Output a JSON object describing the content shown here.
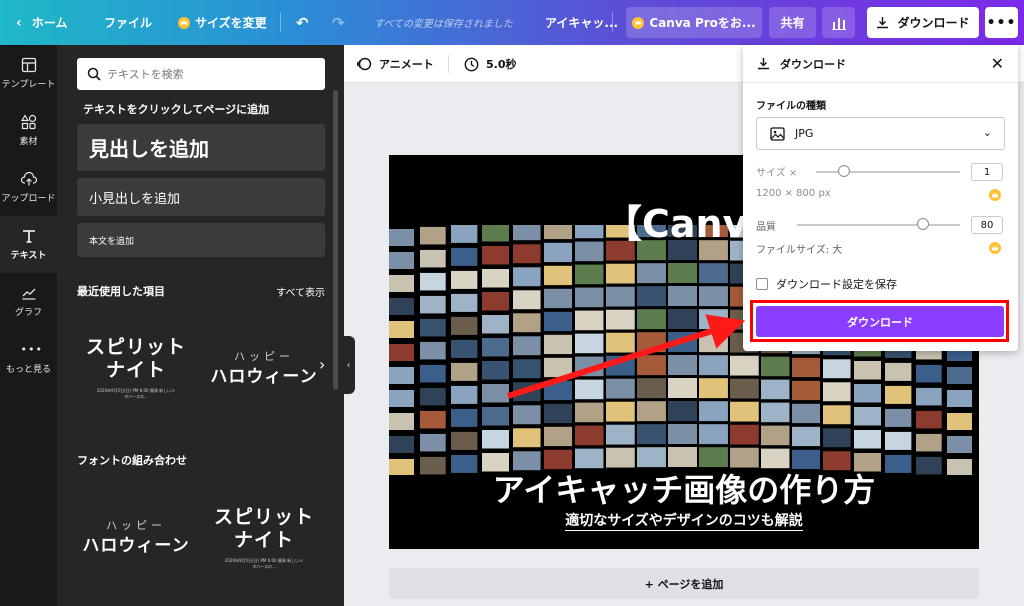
{
  "topbar": {
    "home": "ホーム",
    "file": "ファイル",
    "resize": "サイズを変更",
    "saved_status": "すべての変更は保存されました",
    "doc_title": "アイキャッ...",
    "pro_trial": "Canva Proをお...",
    "share": "共有",
    "download": "ダウンロード"
  },
  "rail": {
    "items": [
      {
        "label": "テンプレート",
        "icon": "template-icon"
      },
      {
        "label": "素材",
        "icon": "elements-icon"
      },
      {
        "label": "アップロード",
        "icon": "upload-icon"
      },
      {
        "label": "テキスト",
        "icon": "text-icon"
      },
      {
        "label": "グラフ",
        "icon": "chart-icon"
      },
      {
        "label": "もっと見る",
        "icon": "more-icon"
      }
    ]
  },
  "panel": {
    "search_placeholder": "テキストを検索",
    "click_hint": "テキストをクリックしてページに追加",
    "heading_btn": "見出しを追加",
    "subheading_btn": "小見出しを追加",
    "body_btn": "本文を追加",
    "recent_title": "最近使用した項目",
    "see_all": "すべて表示",
    "combo_title": "フォントの組み合わせ",
    "card_spirit": "スピリット\nナイト",
    "card_happy": "ハッピー",
    "card_halloween": "ハロウィーン",
    "card_small_text": "2020年9月5日(日) PM 6:00 開演 新しいメタバースの..."
  },
  "editor": {
    "animate": "アニメート",
    "duration": "5.0秒",
    "add_page": "+ ページを追加"
  },
  "canvas": {
    "title": "【Canva",
    "headline": "アイキャッチ画像の作り方",
    "subline": "適切なサイズやデザインのコツも解説"
  },
  "download_popup": {
    "title": "ダウンロード",
    "file_type_label": "ファイルの種類",
    "file_type_value": "JPG",
    "size_label": "サイズ ×",
    "size_value": "1",
    "dimensions": "1200 × 800 px",
    "quality_label": "品質",
    "quality_value": "80",
    "file_size": "ファイルサイズ: 大",
    "save_settings": "ダウンロード設定を保存",
    "download_button": "ダウンロード"
  },
  "colors": {
    "accent_purple": "#8b3dff",
    "highlight_red": "#ff0000",
    "pro_crown": "#ffc233"
  }
}
